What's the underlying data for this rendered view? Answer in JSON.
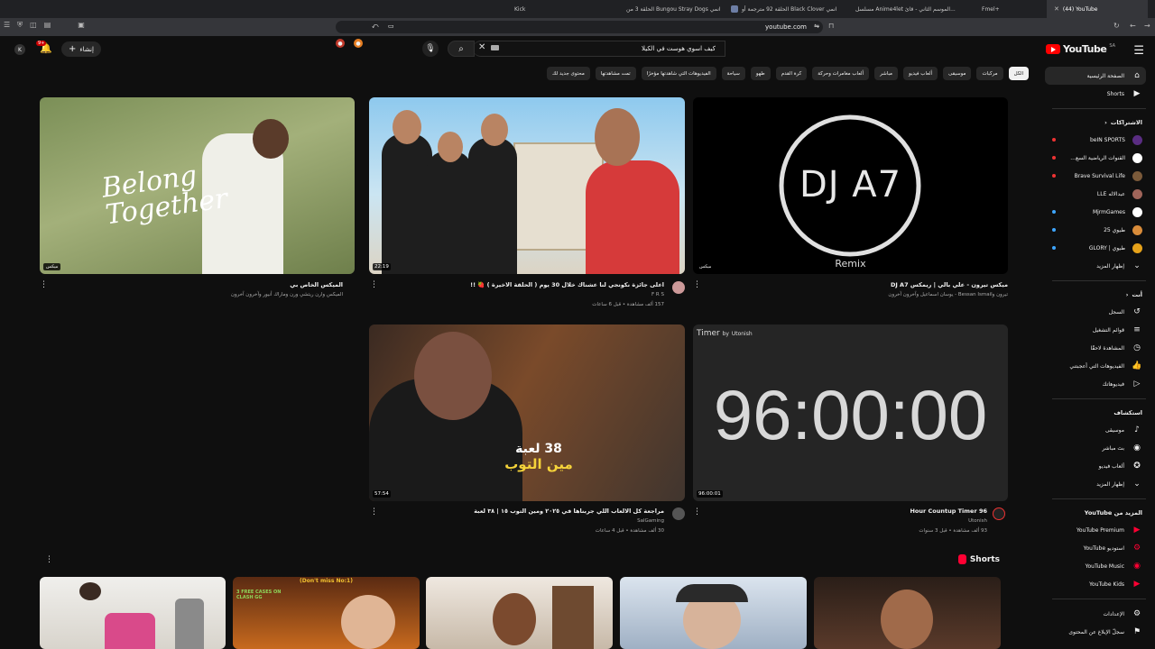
{
  "browser": {
    "tabs": [
      {
        "label": "(44) YouTube",
        "active": true
      },
      {
        "label": "Fmel+",
        "active": false
      },
      {
        "label": "مسلسل Anime4let الموسم الثاني - قائ...",
        "active": false
      },
      {
        "label": "الحلقة 92 مترجمة أو Black Clover انمي",
        "active": false
      },
      {
        "label": "الحلقة 3 من Bungou Stray Dogs انمي",
        "active": false
      },
      {
        "label": "Kick",
        "active": false
      }
    ],
    "close_tab_label": "✕",
    "url": "youtube.com"
  },
  "masthead": {
    "logo_text": "YouTube",
    "logo_cc": "SA",
    "search_query": "كيف اسوي هوست في الكيلا",
    "create_label": "إنشاء",
    "notification_count": "9+"
  },
  "chips": [
    {
      "label": "الكل",
      "active": true
    },
    {
      "label": "مركبات",
      "active": false
    },
    {
      "label": "موسيقى",
      "active": false
    },
    {
      "label": "ألعاب فيديو",
      "active": false
    },
    {
      "label": "مباشر",
      "active": false
    },
    {
      "label": "ألعاب مغامرات وحركة",
      "active": false
    },
    {
      "label": "كرة القدم",
      "active": false
    },
    {
      "label": "طهو",
      "active": false
    },
    {
      "label": "سياحة",
      "active": false
    },
    {
      "label": "الفيديوهات التي شاهدتها مؤخرًا",
      "active": false
    },
    {
      "label": "تمت مشاهدتها",
      "active": false
    },
    {
      "label": "محتوى جديد لك",
      "active": false
    }
  ],
  "sidebar": {
    "main": [
      {
        "label": "الصفحة الرئيسية",
        "icon": "home-icon",
        "glyph": "⌂",
        "active": true
      },
      {
        "label": "Shorts",
        "icon": "shorts-icon",
        "glyph": "▶",
        "active": false
      }
    ],
    "subs_heading": "الاشتراكات",
    "subscriptions": [
      {
        "label": "beIN SPORTS",
        "color": "#5a2d82",
        "dot": "red"
      },
      {
        "label": "القنوات الرياضية السع...",
        "color": "#ffffff",
        "dot": "red"
      },
      {
        "label": "Brave Survival Life",
        "color": "#7b5a3a",
        "dot": "red"
      },
      {
        "label": "عبدالاله LLE",
        "color": "#a0655a",
        "dot": ""
      },
      {
        "label": "MjrmGames",
        "color": "#ffffff",
        "dot": "blue"
      },
      {
        "label": "طيوي 25",
        "color": "#d98c3a",
        "dot": "blue"
      },
      {
        "label": "طيوي | GLORY",
        "color": "#e6a21a",
        "dot": "blue"
      },
      {
        "label": "إظهار المزيد",
        "color": "",
        "dot": ""
      }
    ],
    "you_heading": "أنت",
    "you": [
      {
        "label": "السجل",
        "glyph": "↺"
      },
      {
        "label": "قوائم التشغيل",
        "glyph": "≡"
      },
      {
        "label": "المشاهدة لاحقًا",
        "glyph": "◷"
      },
      {
        "label": "الفيديوهات التي أعجبتني",
        "glyph": "👍"
      },
      {
        "label": "فيديوهاتك",
        "glyph": "▷"
      }
    ],
    "explore_heading": "استكشاف",
    "explore": [
      {
        "label": "موسيقى",
        "glyph": "♪"
      },
      {
        "label": "بث مباشر",
        "glyph": "◉"
      },
      {
        "label": "ألعاب فيديو",
        "glyph": "✪"
      },
      {
        "label": "إظهار المزيد",
        "glyph": "⌄"
      }
    ],
    "more_heading": "المزيد من YouTube",
    "more": [
      {
        "label": "YouTube Premium"
      },
      {
        "label": "استوديو YouTube"
      },
      {
        "label": "YouTube Music"
      },
      {
        "label": "YouTube Kids"
      }
    ],
    "settings": [
      {
        "label": "الإعدادات",
        "glyph": "⚙"
      },
      {
        "label": "سجلّ الإبلاغ عن المحتوى",
        "glyph": "⚑"
      }
    ]
  },
  "videos": [
    {
      "title": "ميكس تيرون - علي بالي | ريمكس DJ A7",
      "channel": "تيرون وBessan Ismail - يوسان اسماعيل وآخرون آخرون",
      "meta": "",
      "badge": "ميكس",
      "duration": ""
    },
    {
      "title": "اعلى جائزة نكونجي لنا عشناك خلال 30 يوم ( الحلقة الاخيرة ) 🍓 !!",
      "channel": "F R S",
      "meta": "157 ألف مشاهدة • قبل 6 ساعات",
      "badge": "",
      "duration": "22:19"
    },
    {
      "title": "الميكس الخاص بي",
      "channel": "الميكس وارن ريتشي ورن وماراك أنيور وآخرون آخرون",
      "meta": "",
      "badge": "ميكس",
      "duration": ""
    },
    {
      "title": "96 Hour Countup Timer",
      "channel": "Utonish",
      "meta": "93 ألف مشاهدة • قبل 3 سنوات",
      "badge": "",
      "duration": "96:00:01"
    },
    {
      "title": "مراجعة كل الالعاب اللي جربناها في ٢٠٢٥ ومين التوب ١٥ | ٣٨ لعبة",
      "channel": "SalGaming",
      "meta": "30 ألف مشاهدة • قبل 4 ساعات",
      "badge": "",
      "duration": "57:54"
    }
  ],
  "thumb_text": {
    "belong": "Belong Together",
    "dj": "DJ A7",
    "remix": "Remix",
    "timer_label": "Timer",
    "timer_by": "by",
    "timer_brand": "Utonish",
    "timer_big": "96:00:00",
    "games_line1": "38 لعبة",
    "games_line2": "مين التوب",
    "short1_banner": "(Don't miss No:1)",
    "short1_sub": "3 FREE CASES ON CLASH GG"
  },
  "shorts_heading": "Shorts",
  "colors": {
    "youtube_red": "#ff0000",
    "bg": "#0f0f0f",
    "chip_bg": "#272727"
  }
}
